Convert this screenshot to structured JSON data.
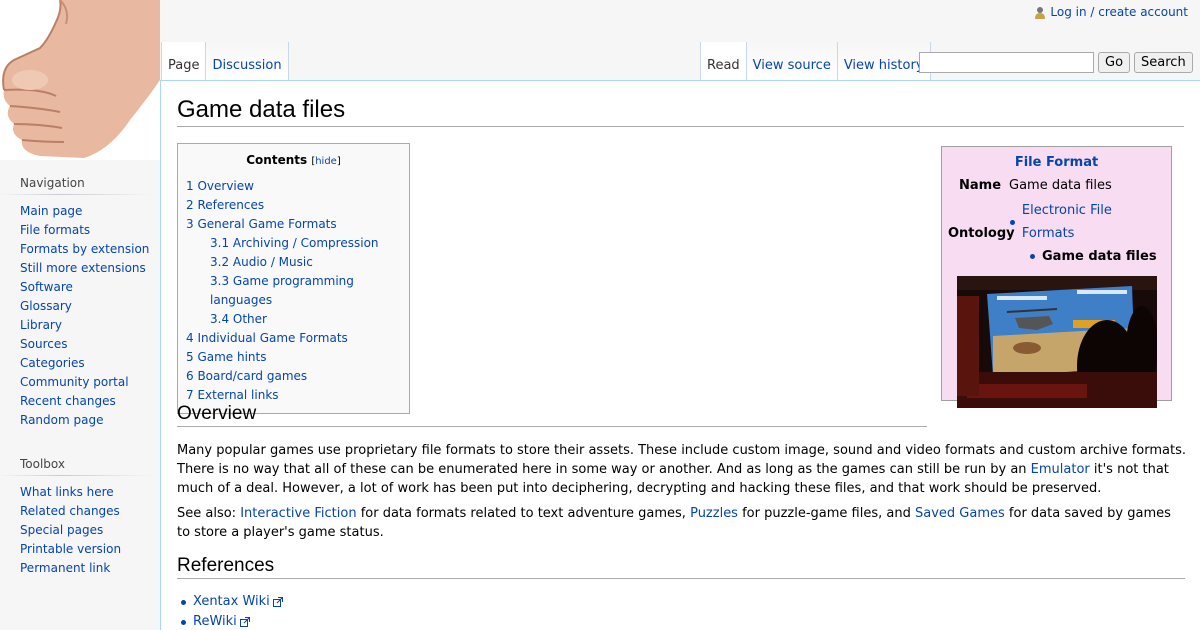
{
  "personal": {
    "login": "Log in / create account"
  },
  "tabs": {
    "left": [
      {
        "label": "Page",
        "selected": true
      },
      {
        "label": "Discussion",
        "selected": false
      }
    ],
    "right": [
      {
        "label": "Read",
        "selected": true
      },
      {
        "label": "View source",
        "selected": false
      },
      {
        "label": "View history",
        "selected": false
      }
    ]
  },
  "search": {
    "value": "",
    "go_label": "Go",
    "search_label": "Search"
  },
  "sidebar": {
    "navigation_heading": "Navigation",
    "navigation": [
      "Main page",
      "File formats",
      "Formats by extension",
      "Still more extensions",
      "Software",
      "Glossary",
      "Library",
      "Sources",
      "Categories",
      "Community portal",
      "Recent changes",
      "Random page"
    ],
    "toolbox_heading": "Toolbox",
    "toolbox": [
      "What links here",
      "Related changes",
      "Special pages",
      "Printable version",
      "Permanent link"
    ]
  },
  "page": {
    "title": "Game data files",
    "toc": {
      "title": "Contents",
      "hide": "hide",
      "items": [
        {
          "label": "1 Overview",
          "level": 1
        },
        {
          "label": "2 References",
          "level": 1
        },
        {
          "label": "3 General Game Formats",
          "level": 1
        },
        {
          "label": "3.1 Archiving / Compression",
          "level": 2
        },
        {
          "label": "3.2 Audio / Music",
          "level": 2
        },
        {
          "label": "3.3 Game programming languages",
          "level": 2
        },
        {
          "label": "3.4 Other",
          "level": 2
        },
        {
          "label": "4 Individual Game Formats",
          "level": 1
        },
        {
          "label": "5 Game hints",
          "level": 1
        },
        {
          "label": "6 Board/card games",
          "level": 1
        },
        {
          "label": "7 External links",
          "level": 1
        }
      ]
    },
    "infobox": {
      "title": "File Format",
      "name_label": "Name",
      "name_value": "Game data files",
      "ontology_label": "Ontology",
      "ontology_parent": "Electronic File Formats",
      "ontology_child": "Game data files"
    },
    "overview": {
      "heading": "Overview",
      "p1_a": "Many popular games use proprietary file formats to store their assets. These include custom image, sound and video formats and custom archive formats. There is no way that all of these can be enumerated here in some way or another. And as long as the games can still be run by an ",
      "p1_link": "Emulator",
      "p1_b": " it's not that much of a deal. However, a lot of work has been put into deciphering, decrypting and hacking these files, and that work should be preserved.",
      "p2_a": "See also: ",
      "p2_link1": "Interactive Fiction",
      "p2_b": " for data formats related to text adventure games, ",
      "p2_link2": "Puzzles",
      "p2_c": " for puzzle-game files, and ",
      "p2_link3": "Saved Games",
      "p2_d": " for data saved by games to store a player's game status."
    },
    "references": {
      "heading": "References",
      "items": [
        "Xentax Wiki",
        "ReWiki"
      ]
    }
  },
  "colors": {
    "link": "#0645ad",
    "infobox_bg": "#f7dcf2",
    "toc_bg": "#f9f9f9"
  }
}
